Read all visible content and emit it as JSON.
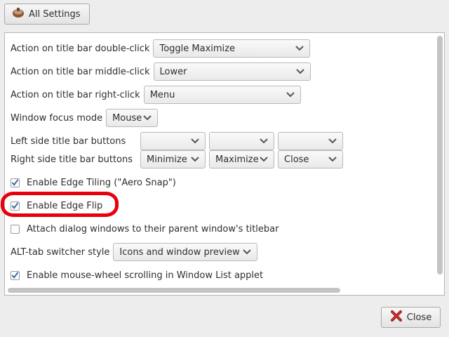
{
  "top_button": {
    "label": "All Settings",
    "icon": "settings-brush-icon"
  },
  "settings": {
    "double_click": {
      "label": "Action on title bar double-click",
      "value": "Toggle Maximize"
    },
    "middle_click": {
      "label": "Action on title bar middle-click",
      "value": "Lower"
    },
    "right_click": {
      "label": "Action on title bar right-click",
      "value": "Menu"
    },
    "focus_mode": {
      "label": "Window focus mode",
      "value": "Mouse"
    },
    "left_buttons": {
      "label": "Left side title bar buttons",
      "values": [
        "",
        "",
        ""
      ]
    },
    "right_buttons": {
      "label": "Right side title bar buttons",
      "values": [
        "Minimize",
        "Maximize",
        "Close"
      ]
    },
    "edge_tiling": {
      "label": "Enable Edge Tiling (\"Aero Snap\")",
      "checked": true
    },
    "edge_flip": {
      "label": "Enable Edge Flip",
      "checked": true
    },
    "attach_dialogs": {
      "label": "Attach dialog windows to their parent window's titlebar",
      "checked": false
    },
    "alt_tab": {
      "label": "ALT-tab switcher style",
      "value": "Icons and window preview"
    },
    "mouse_wheel": {
      "label": "Enable mouse-wheel scrolling in Window List applet",
      "checked": true
    }
  },
  "close_button": {
    "label": "Close",
    "icon": "close-icon"
  },
  "colors": {
    "highlight": "#e8000b",
    "check": "#3c6fb0"
  }
}
